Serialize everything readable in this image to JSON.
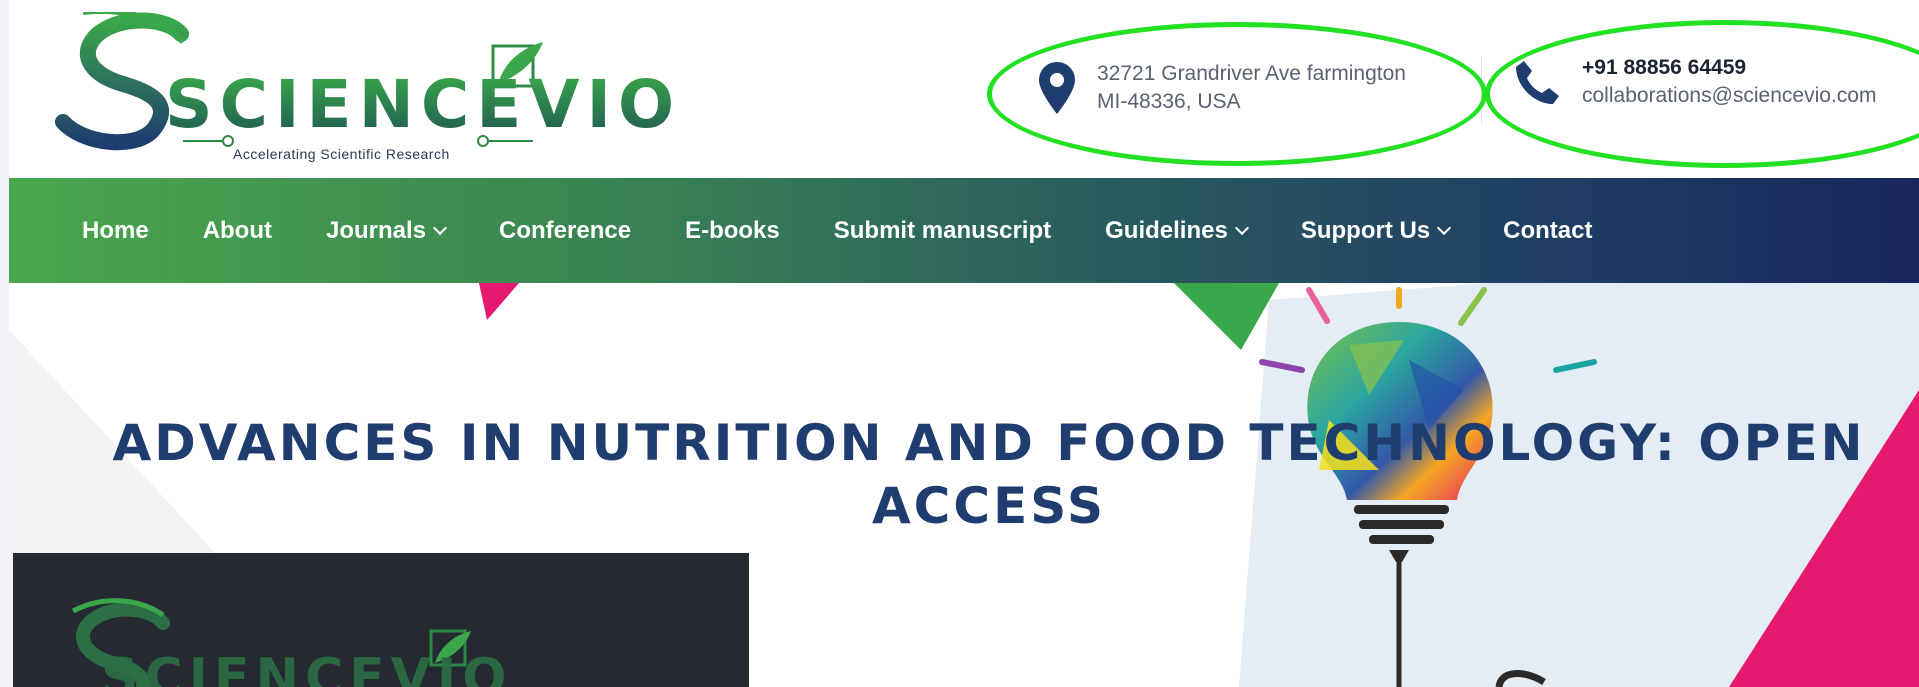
{
  "brand": {
    "name": "SCIENCEVIO",
    "tagline": "Accelerating Scientific Research",
    "colors": {
      "green": "#2f8a45",
      "navy": "#1f3d6e",
      "highlight": "#22e022"
    }
  },
  "contact": {
    "address_line1": "32721 Grandriver Ave farmington",
    "address_line2": "MI-48336, USA",
    "phone": "+91 88856 64459",
    "email": "collaborations@sciencevio.com",
    "address_icon": "map-pin-icon",
    "phone_icon": "phone-icon"
  },
  "nav": {
    "items": [
      {
        "label": "Home",
        "dropdown": false
      },
      {
        "label": "About",
        "dropdown": false
      },
      {
        "label": "Journals",
        "dropdown": true
      },
      {
        "label": "Conference",
        "dropdown": false
      },
      {
        "label": "E-books",
        "dropdown": false
      },
      {
        "label": "Submit manuscript",
        "dropdown": false
      },
      {
        "label": "Guidelines",
        "dropdown": true
      },
      {
        "label": "Support Us",
        "dropdown": true
      },
      {
        "label": "Contact",
        "dropdown": false
      }
    ],
    "gradient": [
      "#4aa74b",
      "#18255c"
    ]
  },
  "hero": {
    "title_line1": "ADVANCES IN NUTRITION AND FOOD TECHNOLOGY: OPEN",
    "title_line2": "ACCESS",
    "illustration": "lightbulb-illustration",
    "preview_brand": "SCIENCEVIO"
  }
}
